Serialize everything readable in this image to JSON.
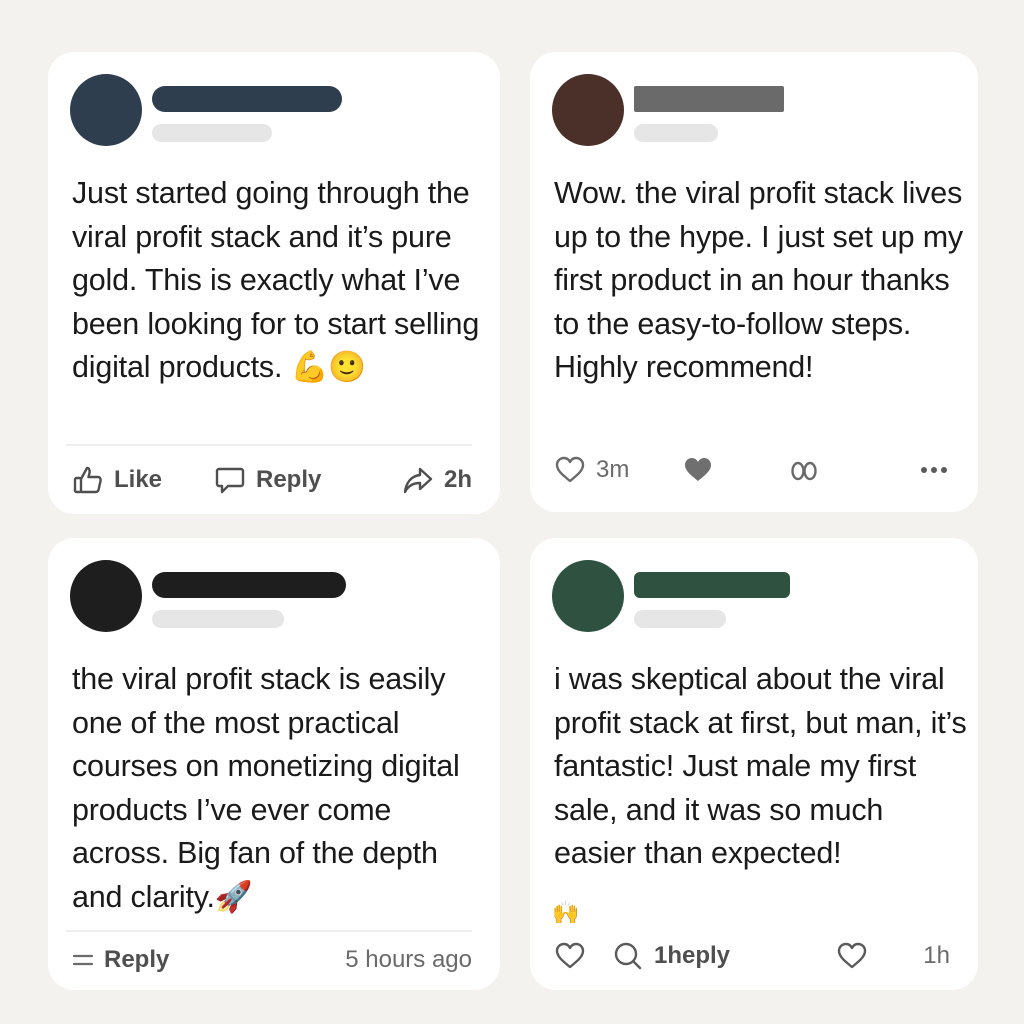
{
  "posts": [
    {
      "avatar_color": "#2f3e4e",
      "name_color": "#2f3e4e",
      "text": "Just started going through the viral profit stack and it’s pure gold. This is exactly what I’ve been looking for to start selling digital products.",
      "emojis": "💪🙂",
      "actions": {
        "like": "Like",
        "reply": "Reply",
        "time": "2h"
      },
      "icons": [
        "thumbs-up-icon",
        "speech-bubble-icon",
        "share-arrow-icon"
      ]
    },
    {
      "avatar_color": "#4a3028",
      "name_color": "#6a6a6a",
      "text": "Wow. the viral profit stack lives up to the hype. I just set up my first product in an hour thanks to the easy-to-follow steps. Highly recommend!",
      "actions": {
        "time": "3m"
      },
      "icons": [
        "heart-outline-icon",
        "heart-filled-icon",
        "eyes-icon",
        "more-dots-icon"
      ]
    },
    {
      "avatar_color": "#1e1e1e",
      "name_color": "#1e1e1e",
      "text": "the viral profit stack is easily one of the most practical courses on monetizing digital products I’ve ever come across. Big fan of the depth and clarity.",
      "emojis": "🚀",
      "actions": {
        "reply": "Reply",
        "time": "5 hours ago"
      },
      "icons": [
        "menu-lines-icon"
      ]
    },
    {
      "avatar_color": "#2f5240",
      "name_color": "#2f5240",
      "text": "i was skeptical about the viral profit stack at first, but man, it’s fantastic! Just male my first sale, and it was so much easier than expected!",
      "emojis": "🙌",
      "actions": {
        "reply": "1heply",
        "time": "1h"
      },
      "icons": [
        "heart-outline-icon",
        "search-bubble-icon",
        "heart-outline-icon"
      ]
    }
  ]
}
